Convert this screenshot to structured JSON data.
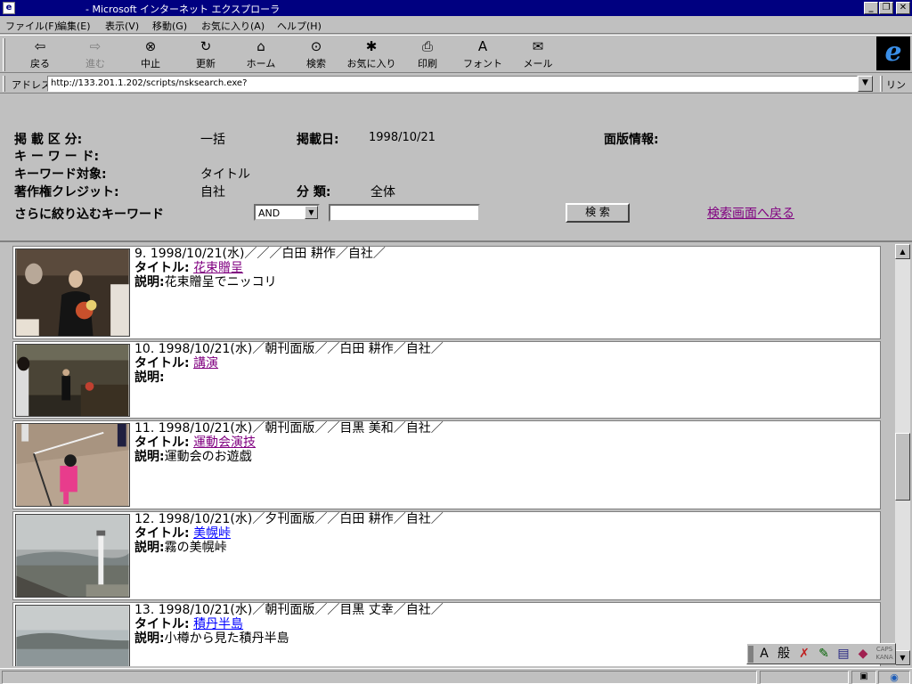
{
  "window": {
    "title": "- Microsoft インターネット エクスプローラ",
    "icon": "ie-document-icon",
    "minimize": "_",
    "restore": "❐",
    "close": "✕"
  },
  "menu": {
    "items": [
      "ファイル(F)",
      "編集(E)",
      "表示(V)",
      "移動(G)",
      "お気に入り(A)",
      "ヘルプ(H)"
    ]
  },
  "toolbar": {
    "buttons": [
      {
        "label": "戻る",
        "icon": "back-arrow-icon",
        "glyph": "⇦",
        "enabled": true
      },
      {
        "label": "進む",
        "icon": "forward-arrow-icon",
        "glyph": "⇨",
        "enabled": false
      },
      {
        "label": "中止",
        "icon": "stop-icon",
        "glyph": "⊗",
        "enabled": true
      },
      {
        "label": "更新",
        "icon": "refresh-icon",
        "glyph": "↻",
        "enabled": true
      },
      {
        "label": "ホーム",
        "icon": "home-icon",
        "glyph": "⌂",
        "enabled": true
      },
      {
        "label": "検索",
        "icon": "search-icon",
        "glyph": "⊙",
        "enabled": true
      },
      {
        "label": "お気に入り",
        "icon": "favorites-icon",
        "glyph": "✱",
        "enabled": true
      },
      {
        "label": "印刷",
        "icon": "print-icon",
        "glyph": "⎙",
        "enabled": true
      },
      {
        "label": "フォント",
        "icon": "font-icon",
        "glyph": "A",
        "enabled": true
      },
      {
        "label": "メール",
        "icon": "mail-icon",
        "glyph": "✉",
        "enabled": true
      }
    ],
    "logo": "e"
  },
  "address": {
    "label": "アドレス",
    "url": "http://133.201.1.202/scripts/nsksearch.exe?",
    "links_label": "リンク"
  },
  "search_panel": {
    "publish_category_label": "掲 載 区 分:",
    "publish_category_value": "一括",
    "publish_date_label": "掲載日:",
    "publish_date_value": "1998/10/21",
    "edition_info_label": "面版情報:",
    "keyword_label": "キ ー ワ ー ド:",
    "keyword_target_label": "キーワード対象:",
    "keyword_target_value": "タイトル",
    "copyright_label": "著作権クレジット:",
    "copyright_value": "自社",
    "classification_label": "分 類:",
    "classification_value": "全体",
    "refine_label": "さらに絞り込むキーワード",
    "operator_value": "AND",
    "refine_input_value": "",
    "search_button": "検 索",
    "back_link": "検索画面へ戻る"
  },
  "results": [
    {
      "number": "9.",
      "meta": "1998/10/21(水)／／／白田 耕作／自社／",
      "title_label": "タイトル:",
      "title": "花束贈呈",
      "desc_label": "説明:",
      "desc": "花束贈呈でニッコリ",
      "visited": true,
      "thumb": "photo-bouquet"
    },
    {
      "number": "10.",
      "meta": "1998/10/21(水)／朝刊面版／／白田 耕作／自社／",
      "title_label": "タイトル:",
      "title": "講演",
      "desc_label": "説明:",
      "desc": "",
      "visited": true,
      "thumb": "photo-lecture"
    },
    {
      "number": "11.",
      "meta": "1998/10/21(水)／朝刊面版／／目黒 美和／自社／",
      "title_label": "タイトル:",
      "title": "運動会演技",
      "desc_label": "説明:",
      "desc": "運動会のお遊戯",
      "visited": true,
      "thumb": "photo-sports-day"
    },
    {
      "number": "12.",
      "meta": "1998/10/21(水)／夕刊面版／／白田 耕作／自社／",
      "title_label": "タイトル:",
      "title": "美幌峠",
      "desc_label": "説明:",
      "desc": "霧の美幌峠",
      "visited": false,
      "thumb": "photo-bihoro-pass"
    },
    {
      "number": "13.",
      "meta": "1998/10/21(水)／朝刊面版／／目黒 丈幸／自社／",
      "title_label": "タイトル:",
      "title": "積丹半島",
      "desc_label": "説明:",
      "desc": "小樽から見た積丹半島",
      "visited": false,
      "thumb": "photo-shakotan"
    }
  ],
  "ime_toolbar": {
    "mode": "A",
    "style": "般"
  },
  "colors": {
    "titlebar": "#000080",
    "visited_link": "#800080",
    "link": "#0000ff",
    "chrome": "#c0c0c0"
  }
}
